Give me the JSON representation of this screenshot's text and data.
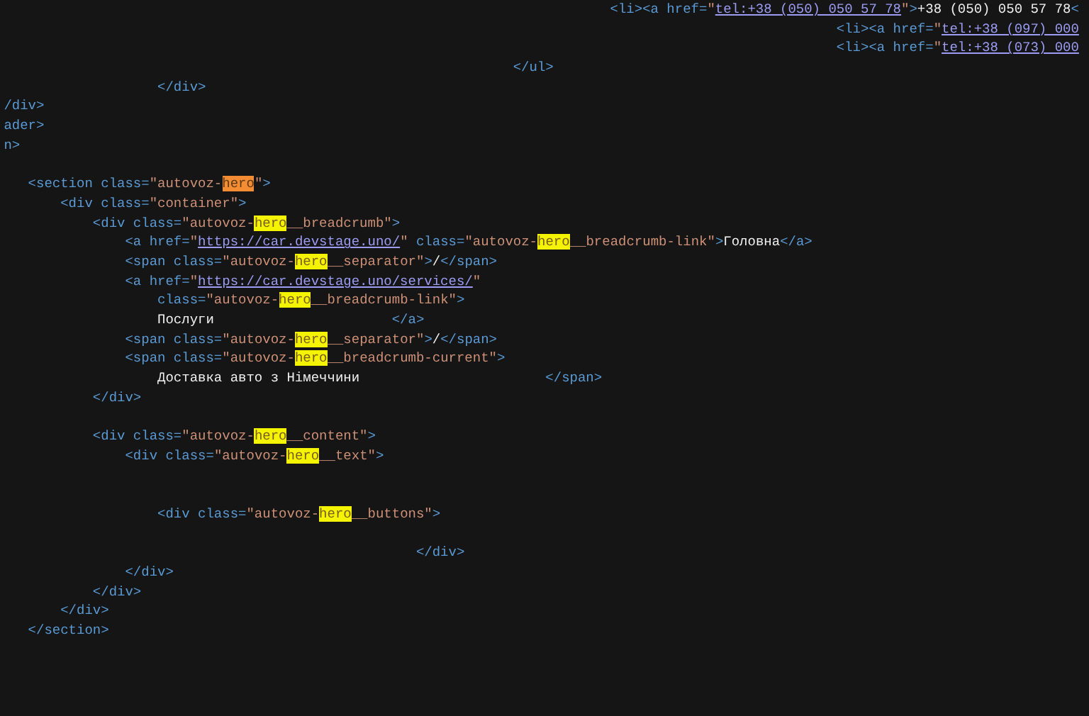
{
  "editor": {
    "lines": [
      {
        "kind": "code",
        "tokens": [
          {
            "kind": "tag",
            "text": "                                                                            <li><a href="
          },
          {
            "kind": "value",
            "text": "\""
          },
          {
            "kind": "link",
            "text": "tel:+38 (050) 050 57 78"
          },
          {
            "kind": "value",
            "text": "\""
          },
          {
            "kind": "tag",
            "text": ">"
          },
          {
            "kind": "text",
            "text": "+38 (050) 050 57 78"
          },
          {
            "kind": "tag",
            "text": "<"
          }
        ]
      },
      {
        "kind": "code",
        "tokens": [
          {
            "kind": "tag",
            "text": "                                                                                                        <li><a href="
          },
          {
            "kind": "value",
            "text": "\""
          },
          {
            "kind": "link",
            "text": "tel:+38 (097) 000"
          }
        ]
      },
      {
        "kind": "code",
        "tokens": [
          {
            "kind": "tag",
            "text": "                                                                                                        <li><a href="
          },
          {
            "kind": "value",
            "text": "\""
          },
          {
            "kind": "link",
            "text": "tel:+38 (073) 000"
          }
        ]
      },
      {
        "kind": "code",
        "tokens": [
          {
            "kind": "tag",
            "text": "                                                                </ul>"
          }
        ]
      },
      {
        "kind": "code",
        "tokens": [
          {
            "kind": "tag",
            "text": "                    </div>"
          }
        ]
      },
      {
        "kind": "code",
        "tokens": [
          {
            "kind": "tag",
            "text": " /div>"
          }
        ]
      },
      {
        "kind": "code",
        "tokens": [
          {
            "kind": "tag",
            "text": " ader>"
          }
        ]
      },
      {
        "kind": "code",
        "tokens": [
          {
            "kind": "tag",
            "text": " n>"
          }
        ]
      },
      {
        "kind": "blank"
      },
      {
        "kind": "code",
        "tokens": [
          {
            "kind": "tag",
            "text": "    <section class="
          },
          {
            "kind": "value",
            "text": "\"autovoz-"
          },
          {
            "kind": "match",
            "text": "hero",
            "selected": true
          },
          {
            "kind": "value",
            "text": "\""
          },
          {
            "kind": "tag",
            "text": ">"
          }
        ]
      },
      {
        "kind": "code",
        "tokens": [
          {
            "kind": "tag",
            "text": "        <div class="
          },
          {
            "kind": "value",
            "text": "\"container\""
          },
          {
            "kind": "tag",
            "text": ">"
          }
        ]
      },
      {
        "kind": "code",
        "tokens": [
          {
            "kind": "tag",
            "text": "            <div class="
          },
          {
            "kind": "value",
            "text": "\"autovoz-"
          },
          {
            "kind": "match",
            "text": "hero",
            "selected": false
          },
          {
            "kind": "value",
            "text": "__breadcrumb\""
          },
          {
            "kind": "tag",
            "text": ">"
          }
        ]
      },
      {
        "kind": "code",
        "tokens": [
          {
            "kind": "tag",
            "text": "                <a href="
          },
          {
            "kind": "value",
            "text": "\""
          },
          {
            "kind": "link",
            "text": "https://car.devstage.uno/"
          },
          {
            "kind": "value",
            "text": "\""
          },
          {
            "kind": "tag",
            "text": " class="
          },
          {
            "kind": "value",
            "text": "\"autovoz-"
          },
          {
            "kind": "match",
            "text": "hero",
            "selected": false
          },
          {
            "kind": "value",
            "text": "__breadcrumb-link\""
          },
          {
            "kind": "tag",
            "text": ">"
          },
          {
            "kind": "text",
            "text": "Головна"
          },
          {
            "kind": "tag",
            "text": "</a>"
          }
        ]
      },
      {
        "kind": "code",
        "tokens": [
          {
            "kind": "tag",
            "text": "                <span class="
          },
          {
            "kind": "value",
            "text": "\"autovoz-"
          },
          {
            "kind": "match",
            "text": "hero",
            "selected": false
          },
          {
            "kind": "value",
            "text": "__separator\""
          },
          {
            "kind": "tag",
            "text": ">"
          },
          {
            "kind": "text",
            "text": "/"
          },
          {
            "kind": "tag",
            "text": "</span>"
          }
        ]
      },
      {
        "kind": "code",
        "tokens": [
          {
            "kind": "tag",
            "text": "                <a href="
          },
          {
            "kind": "value",
            "text": "\""
          },
          {
            "kind": "link",
            "text": "https://car.devstage.uno/services/"
          },
          {
            "kind": "value",
            "text": "\""
          }
        ]
      },
      {
        "kind": "code",
        "tokens": [
          {
            "kind": "tag",
            "text": "                    class="
          },
          {
            "kind": "value",
            "text": "\"autovoz-"
          },
          {
            "kind": "match",
            "text": "hero",
            "selected": false
          },
          {
            "kind": "value",
            "text": "__breadcrumb-link\""
          },
          {
            "kind": "tag",
            "text": ">"
          }
        ]
      },
      {
        "kind": "code",
        "tokens": [
          {
            "kind": "text",
            "text": "                    Послуги                      "
          },
          {
            "kind": "tag",
            "text": "</a>"
          }
        ]
      },
      {
        "kind": "code",
        "tokens": [
          {
            "kind": "tag",
            "text": "                <span class="
          },
          {
            "kind": "value",
            "text": "\"autovoz-"
          },
          {
            "kind": "match",
            "text": "hero",
            "selected": false
          },
          {
            "kind": "value",
            "text": "__separator\""
          },
          {
            "kind": "tag",
            "text": ">"
          },
          {
            "kind": "text",
            "text": "/"
          },
          {
            "kind": "tag",
            "text": "</span>"
          }
        ]
      },
      {
        "kind": "code",
        "tokens": [
          {
            "kind": "tag",
            "text": "                <span class="
          },
          {
            "kind": "value",
            "text": "\"autovoz-"
          },
          {
            "kind": "match",
            "text": "hero",
            "selected": false
          },
          {
            "kind": "value",
            "text": "__breadcrumb-current\""
          },
          {
            "kind": "tag",
            "text": ">"
          }
        ]
      },
      {
        "kind": "code",
        "tokens": [
          {
            "kind": "text",
            "text": "                    Доставка авто з Німеччини                       "
          },
          {
            "kind": "tag",
            "text": "</span>"
          }
        ]
      },
      {
        "kind": "code",
        "tokens": [
          {
            "kind": "tag",
            "text": "            </div>"
          }
        ]
      },
      {
        "kind": "blank"
      },
      {
        "kind": "code",
        "tokens": [
          {
            "kind": "tag",
            "text": "            <div class="
          },
          {
            "kind": "value",
            "text": "\"autovoz-"
          },
          {
            "kind": "match",
            "text": "hero",
            "selected": false
          },
          {
            "kind": "value",
            "text": "__content\""
          },
          {
            "kind": "tag",
            "text": ">"
          }
        ]
      },
      {
        "kind": "code",
        "tokens": [
          {
            "kind": "tag",
            "text": "                <div class="
          },
          {
            "kind": "value",
            "text": "\"autovoz-"
          },
          {
            "kind": "match",
            "text": "hero",
            "selected": false
          },
          {
            "kind": "value",
            "text": "__text\""
          },
          {
            "kind": "tag",
            "text": ">"
          }
        ]
      },
      {
        "kind": "blank"
      },
      {
        "kind": "blank"
      },
      {
        "kind": "code",
        "tokens": [
          {
            "kind": "tag",
            "text": "                    <div class="
          },
          {
            "kind": "value",
            "text": "\"autovoz-"
          },
          {
            "kind": "match",
            "text": "hero",
            "selected": false
          },
          {
            "kind": "value",
            "text": "__buttons\""
          },
          {
            "kind": "tag",
            "text": ">"
          }
        ]
      },
      {
        "kind": "blank"
      },
      {
        "kind": "code",
        "tokens": [
          {
            "kind": "tag",
            "text": "                                                    </div>"
          }
        ]
      },
      {
        "kind": "code",
        "tokens": [
          {
            "kind": "tag",
            "text": "                </div>"
          }
        ]
      },
      {
        "kind": "code",
        "tokens": [
          {
            "kind": "tag",
            "text": "            </div>"
          }
        ]
      },
      {
        "kind": "code",
        "tokens": [
          {
            "kind": "tag",
            "text": "        </div>"
          }
        ]
      },
      {
        "kind": "code",
        "tokens": [
          {
            "kind": "tag",
            "text": "    </section>"
          }
        ]
      }
    ]
  }
}
